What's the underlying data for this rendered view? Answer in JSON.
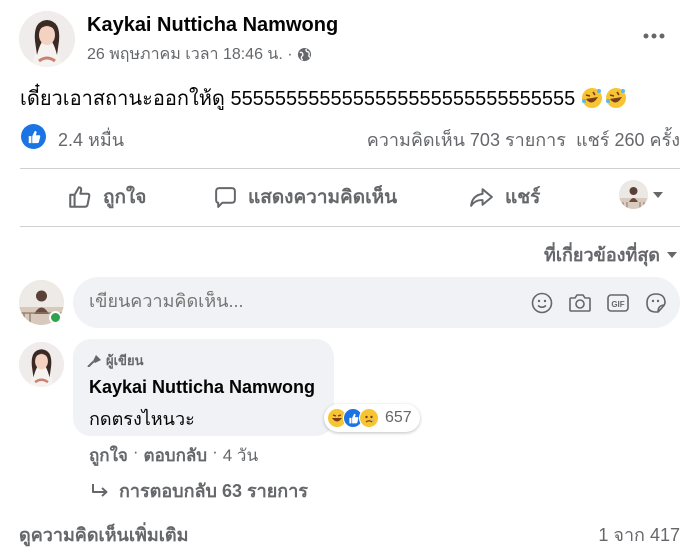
{
  "post": {
    "author": "Kaykai Nutticha Namwong",
    "timestamp": "26 พฤษภาคม เวลา 18:46 น. ·",
    "privacy_icon": "globe-icon",
    "text": "เดี๋ยวเอาสถานะออกให้ดู 5555555555555555555555555555555",
    "emoji": "🤣🤣",
    "likes": "2.4 หมื่น",
    "comments_count": "ความคิดเห็น 703 รายการ",
    "shares_count": "แชร์ 260 ครั้ง"
  },
  "actions": {
    "like": "ถูกใจ",
    "comment": "แสดงความคิดเห็น",
    "share": "แชร์"
  },
  "sort": {
    "label": "ที่เกี่ยวข้องที่สุด"
  },
  "composer": {
    "placeholder": "เขียนความคิดเห็น..."
  },
  "comment": {
    "badge": "ผู้เขียน",
    "author": "Kaykai Nutticha Namwong",
    "text": "กดตรงไหนวะ",
    "reaction_count": "657",
    "like": "ถูกใจ",
    "separator1": "·",
    "reply": "ตอบกลับ",
    "separator2": "·",
    "age": "4 วัน",
    "replies": "การตอบกลับ 63 รายการ"
  },
  "footer": {
    "more_comments": "ดูความคิดเห็นเพิ่มเติม",
    "pager": "1 จาก 417"
  },
  "colors": {
    "accent": "#1b74e4",
    "text": "#050505",
    "secondary": "#65676b",
    "bubble": "#f0f2f5"
  }
}
